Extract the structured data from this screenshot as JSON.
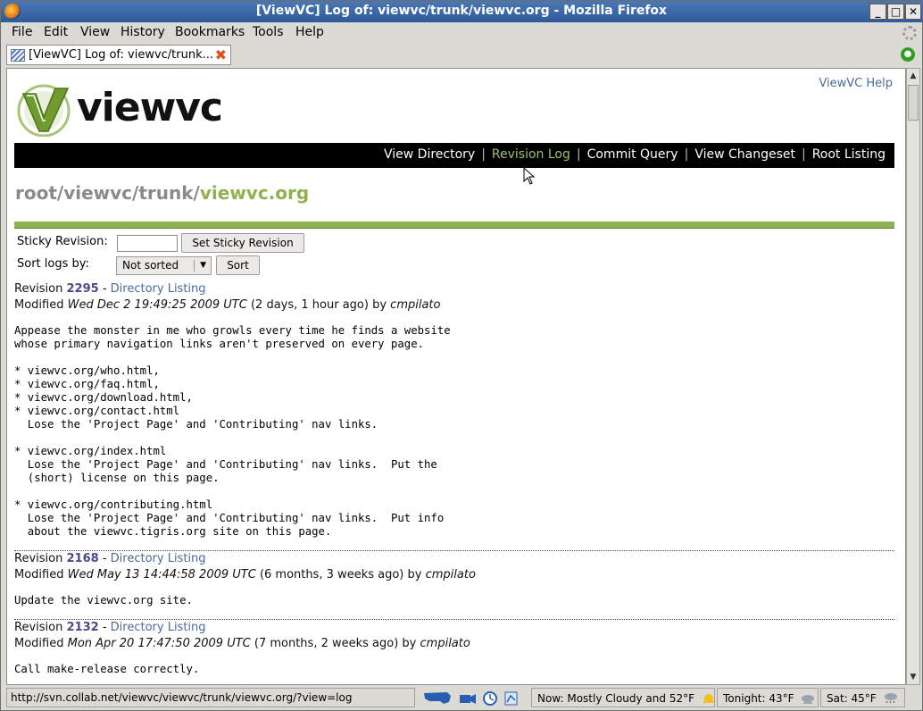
{
  "window": {
    "title": "[ViewVC] Log of: viewvc/trunk/viewvc.org - Mozilla Firefox"
  },
  "menu": {
    "file": "File",
    "edit": "Edit",
    "view": "View",
    "history": "History",
    "bookmarks": "Bookmarks",
    "tools": "Tools",
    "help": "Help"
  },
  "tab": {
    "label": "[ViewVC] Log of: viewvc/trunk..."
  },
  "page": {
    "help_link": "ViewVC Help",
    "logo_text": "viewvc",
    "nav": {
      "view_directory": "View Directory",
      "revision_log": "Revision Log",
      "commit_query": "Commit Query",
      "view_changeset": "View Changeset",
      "root_listing": "Root Listing",
      "separator": "|"
    },
    "path": {
      "prefix": "root/viewvc/trunk/",
      "current": "viewvc.org"
    },
    "sticky": {
      "label": "Sticky Revision:",
      "button": "Set Sticky Revision"
    },
    "sort": {
      "label": "Sort logs by:",
      "selected": "Not sorted",
      "button": "Sort"
    },
    "revisions": [
      {
        "label": "Revision",
        "number": "2295",
        "dash": "-",
        "listing": "Directory Listing",
        "modified": "Modified",
        "date": "Wed Dec 2 19:49:25 2009 UTC",
        "age": "(2 days, 1 hour ago) by",
        "author": "cmpilato",
        "message": "Appease the monster in me who growls every time he finds a website\nwhose primary navigation links aren't preserved on every page.\n\n* viewvc.org/who.html,\n* viewvc.org/faq.html,\n* viewvc.org/download.html,\n* viewvc.org/contact.html\n  Lose the 'Project Page' and 'Contributing' nav links.\n\n* viewvc.org/index.html\n  Lose the 'Project Page' and 'Contributing' nav links.  Put the\n  (short) license on this page.\n\n* viewvc.org/contributing.html\n  Lose the 'Project Page' and 'Contributing' nav links.  Put info\n  about the viewvc.tigris.org site on this page."
      },
      {
        "label": "Revision",
        "number": "2168",
        "dash": "-",
        "listing": "Directory Listing",
        "modified": "Modified",
        "date": "Wed May 13 14:44:58 2009 UTC",
        "age": "(6 months, 3 weeks ago) by",
        "author": "cmpilato",
        "message": "Update the viewvc.org site."
      },
      {
        "label": "Revision",
        "number": "2132",
        "dash": "-",
        "listing": "Directory Listing",
        "modified": "Modified",
        "date": "Mon Apr 20 17:47:50 2009 UTC",
        "age": "(7 months, 2 weeks ago) by",
        "author": "cmpilato",
        "message": "Call make-release correctly."
      }
    ]
  },
  "status": {
    "url": "http://svn.collab.net/viewvc/viewvc/trunk/viewvc.org/?view=log",
    "now": "Now: Mostly Cloudy and 52°F",
    "tonight": "Tonight: 43°F",
    "sat": "Sat: 45°F"
  },
  "colors": {
    "accent_green": "#8fb14f",
    "link_blue": "#4a6a9e",
    "navbar": "#000000"
  }
}
